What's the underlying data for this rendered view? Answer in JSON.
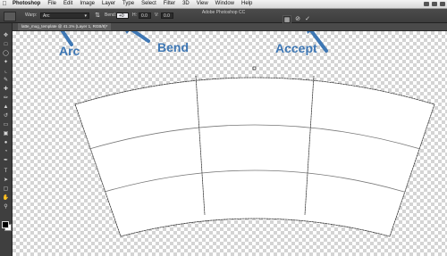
{
  "menubar": {
    "app": "Photoshop",
    "items": [
      "File",
      "Edit",
      "Image",
      "Layer",
      "Type",
      "Select",
      "Filter",
      "3D",
      "View",
      "Window",
      "Help"
    ]
  },
  "options": {
    "warp_label": "Warp:",
    "warp_value": "Arc",
    "bend_label": "Bend:",
    "bend_value": "+0",
    "h_label": "H:",
    "h_value": "0.0",
    "v_label": "V:",
    "v_value": "0.0",
    "app_title": "Adobe Photoshop CC"
  },
  "document": {
    "tab_label": "latte_mug_template @ 41.1% (Layer 1, RGB/8)*"
  },
  "annotations": {
    "arc": "Arc",
    "bend": "Bend",
    "accept": "Accept",
    "color": "#3e77b4"
  },
  "icons": [
    "apple-icon",
    "tool-icons",
    "cancel-transform-icon",
    "commit-checkmark-icon",
    "warp-toggle-icon"
  ]
}
